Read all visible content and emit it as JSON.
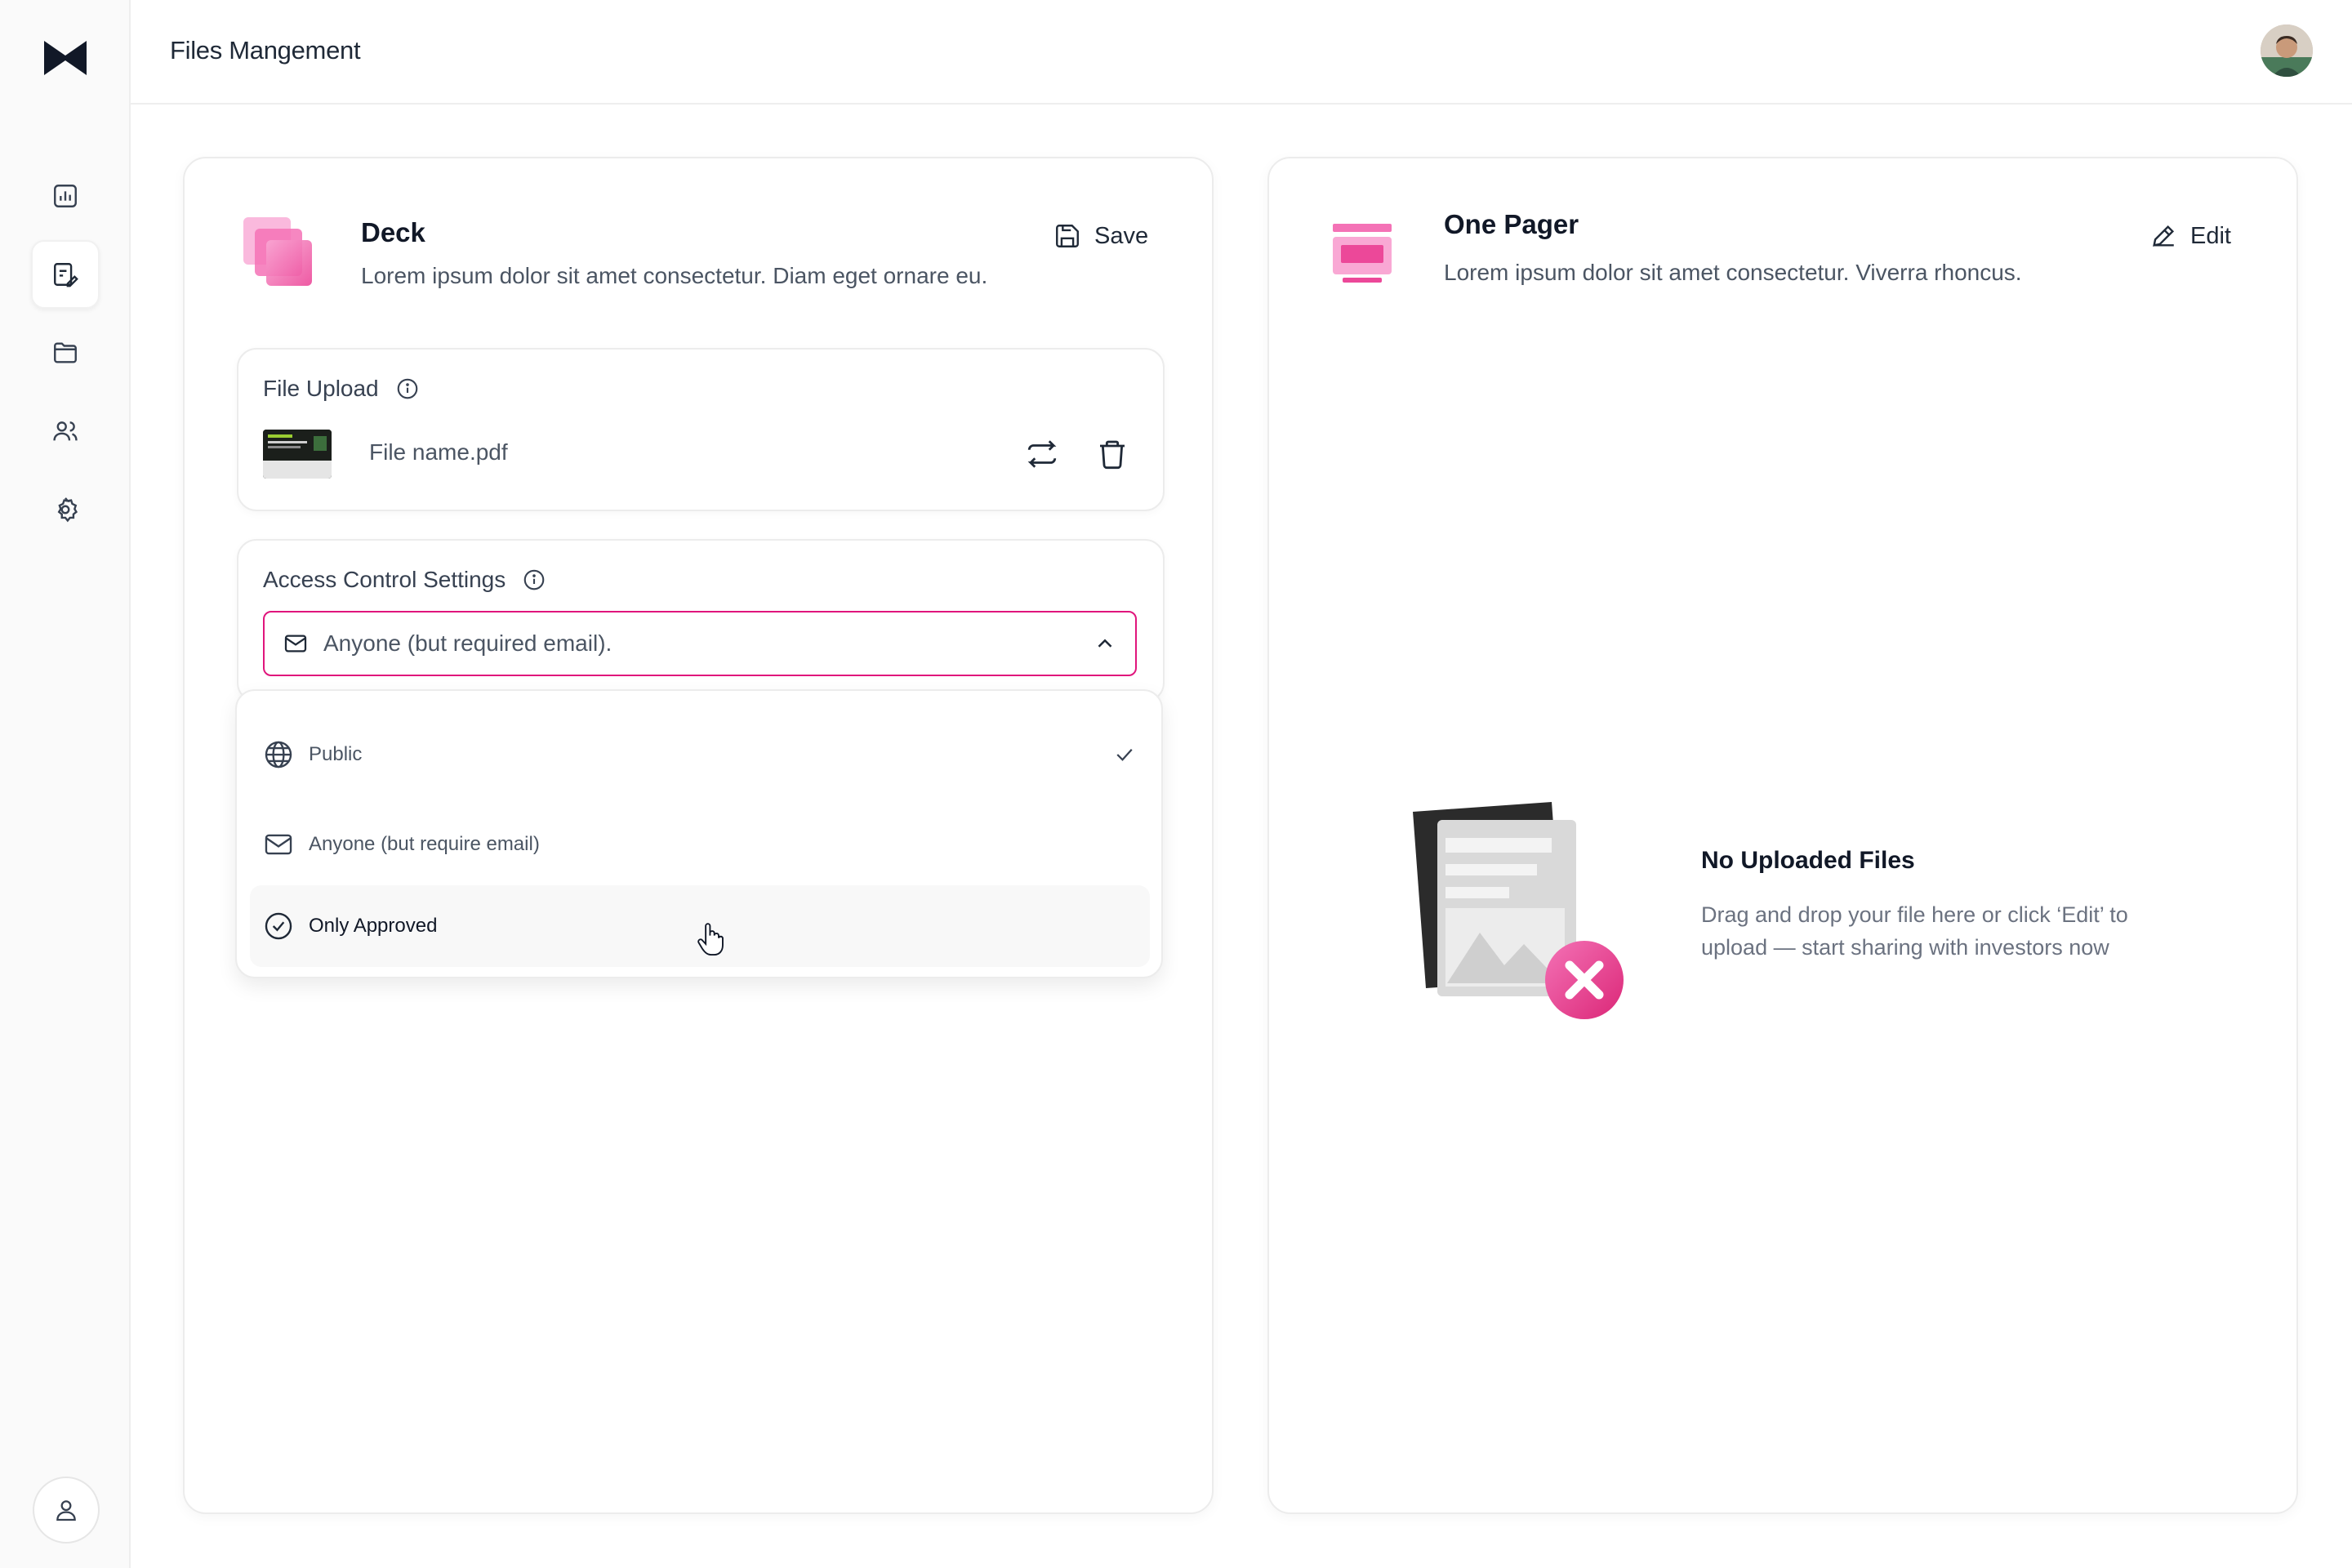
{
  "header": {
    "title": "Files Mangement"
  },
  "sidebar": {
    "items": [
      {
        "name": "analytics"
      },
      {
        "name": "files-management",
        "active": true
      },
      {
        "name": "folders"
      },
      {
        "name": "users"
      },
      {
        "name": "settings"
      }
    ]
  },
  "deck": {
    "title": "Deck",
    "description": "Lorem ipsum dolor sit amet consectetur. Diam eget ornare eu.",
    "save_label": "Save",
    "file_upload": {
      "label": "File Upload",
      "file_name": "File name.pdf"
    },
    "access_control": {
      "label": "Access Control Settings",
      "selected_value": "Anyone (but required email).",
      "options": [
        {
          "label": "Public",
          "icon": "globe-icon",
          "checked": true
        },
        {
          "label": "Anyone (but require email)",
          "icon": "mail-icon",
          "checked": false
        },
        {
          "label": "Only Approved",
          "icon": "check-circle-icon",
          "checked": false,
          "hovered": true
        }
      ]
    }
  },
  "one_pager": {
    "title": "One Pager",
    "description": "Lorem ipsum dolor sit amet consectetur. Viverra rhoncus.",
    "edit_label": "Edit",
    "empty_state": {
      "title": "No Uploaded Files",
      "description": "Drag and drop your file here or click ‘Edit’ to upload — start sharing with investors now"
    }
  },
  "colors": {
    "accent": "#e0157c",
    "accent_light": "#f472b6",
    "border": "#ececec",
    "text_primary": "#111827",
    "text_secondary": "#4b5563"
  }
}
